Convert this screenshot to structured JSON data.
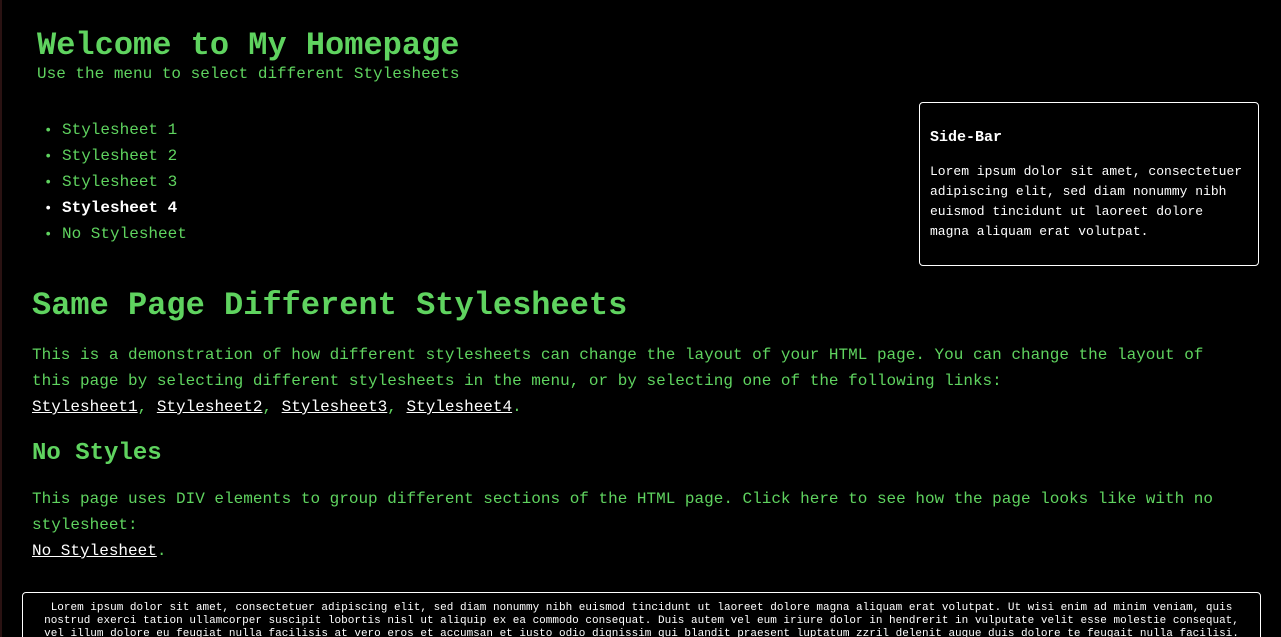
{
  "header": {
    "title": "Welcome to My Homepage",
    "subtitle": "Use the menu to select different Stylesheets"
  },
  "menu": {
    "items": [
      {
        "label": "Stylesheet 1",
        "active": false
      },
      {
        "label": "Stylesheet 2",
        "active": false
      },
      {
        "label": "Stylesheet 3",
        "active": false
      },
      {
        "label": "Stylesheet 4",
        "active": true
      },
      {
        "label": "No Stylesheet",
        "active": false
      }
    ]
  },
  "sidebar": {
    "title": "Side-Bar",
    "text": "Lorem ipsum dolor sit amet, consectetuer adipiscing elit, sed diam nonummy nibh euismod tincidunt ut laoreet dolore magna aliquam erat volutpat."
  },
  "content": {
    "heading": "Same Page Different Stylesheets",
    "intro": "This is a demonstration of how different stylesheets can change the layout of your HTML page. You can change the layout of this page by selecting different stylesheets in the menu, or by selecting one of the following links:",
    "links": [
      "Stylesheet1",
      "Stylesheet2",
      "Stylesheet3",
      "Stylesheet4"
    ],
    "separator": ", ",
    "end": ".",
    "nostyle_heading": "No Styles",
    "nostyle_text": "This page uses DIV elements to group different sections of the HTML page. Click here to see how the page looks like with no stylesheet:",
    "nostyle_link": "No Stylesheet",
    "nostyle_end": "."
  },
  "footer": {
    "text": "Lorem ipsum dolor sit amet, consectetuer adipiscing elit, sed diam nonummy nibh euismod tincidunt ut laoreet dolore magna aliquam erat volutpat. Ut wisi enim ad minim veniam, quis nostrud exerci tation ullamcorper suscipit lobortis nisl ut aliquip ex ea commodo consequat. Duis autem vel eum iriure dolor in hendrerit in vulputate velit esse molestie consequat, vel illum dolore eu feugiat nulla facilisis at vero eros et accumsan et iusto odio dignissim qui blandit praesent luptatum zzril delenit augue duis dolore te feugait nulla facilisi."
  },
  "colors": {
    "background": "#000000",
    "text_green": "#5fd35f",
    "link_white": "#ffffff",
    "border": "#ffffff"
  }
}
